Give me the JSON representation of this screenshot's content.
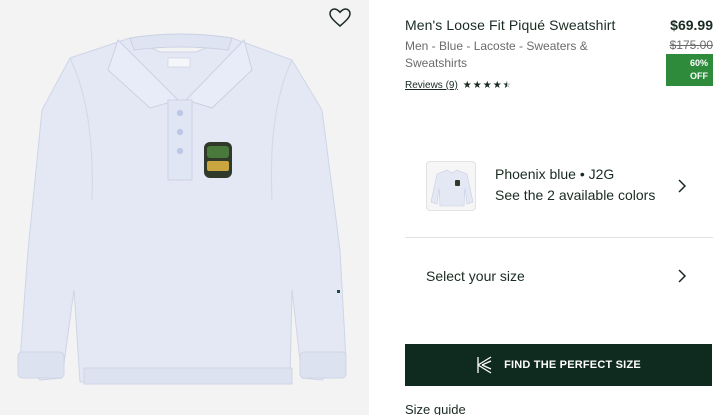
{
  "product": {
    "title": "Men's Loose Fit Piqué Sweatshirt",
    "breadcrumb": "Men - Blue - Lacoste - Sweaters & Sweatshirts",
    "price": "$69.99",
    "old_price": "$175.00",
    "discount_line1": "60%",
    "discount_line2": "OFF",
    "reviews_label": "Reviews (9)",
    "rating_stars": 4.5
  },
  "color": {
    "name": "Phoenix blue • J2G",
    "available": "See the 2 available colors"
  },
  "size": {
    "label": "Select your size"
  },
  "cta": {
    "label": "FIND THE PERFECT SIZE",
    "icon": "kiwisizing-logo-icon"
  },
  "size_guide": {
    "label": "Size guide"
  },
  "icons": {
    "wishlist": "heart-outline-icon",
    "chevron": "chevron-right-icon"
  },
  "colors": {
    "accent_dark": "#0f2a1e",
    "discount_green": "#2e8b3c",
    "sweatshirt": "#e4e8f5"
  }
}
